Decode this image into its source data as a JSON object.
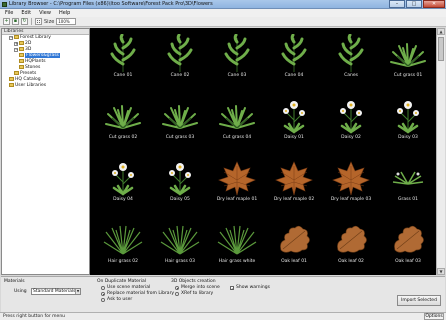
{
  "window": {
    "title": "Library Browser - C:\\Program Files (x86)\\Itoo Software\\Forest Pack Pro\\3D\\Flowers",
    "minimize": "–",
    "maximize": "□",
    "close": "✕"
  },
  "menu": [
    "File",
    "Edit",
    "View",
    "Help"
  ],
  "toolbar": {
    "view_label": "Size",
    "size_value": "100%"
  },
  "tree": {
    "header": "Libraries",
    "items": [
      {
        "label": "Forest Library",
        "indent": 1,
        "expander": "−",
        "selected": false
      },
      {
        "label": "2D",
        "indent": 2,
        "expander": "+",
        "selected": false
      },
      {
        "label": "3D",
        "indent": 2,
        "expander": "−",
        "selected": false
      },
      {
        "label": "Flowers&grass",
        "indent": 3,
        "expander": "",
        "selected": true
      },
      {
        "label": "HQPlants",
        "indent": 3,
        "expander": "",
        "selected": false
      },
      {
        "label": "Stones",
        "indent": 3,
        "expander": "",
        "selected": false
      },
      {
        "label": "Presets",
        "indent": 2,
        "expander": "",
        "selected": false
      },
      {
        "label": "HQ Catalog",
        "indent": 1,
        "expander": "",
        "selected": false
      },
      {
        "label": "User Libraries",
        "indent": 1,
        "expander": "",
        "selected": false
      }
    ]
  },
  "grid": {
    "items": [
      {
        "label": "Cane 01",
        "kind": "cane"
      },
      {
        "label": "Cane 02",
        "kind": "cane"
      },
      {
        "label": "Cane 03",
        "kind": "cane"
      },
      {
        "label": "Cane 04",
        "kind": "cane"
      },
      {
        "label": "Canes",
        "kind": "cane"
      },
      {
        "label": "Cut grass 01",
        "kind": "cutgrass"
      },
      {
        "label": "Cut grass 02",
        "kind": "cutgrass"
      },
      {
        "label": "Cut grass 03",
        "kind": "cutgrass"
      },
      {
        "label": "Cut grass 04",
        "kind": "cutgrass"
      },
      {
        "label": "Daisy 01",
        "kind": "daisy"
      },
      {
        "label": "Daisy 02",
        "kind": "daisy"
      },
      {
        "label": "Daisy 03",
        "kind": "daisy"
      },
      {
        "label": "Daisy 04",
        "kind": "daisy"
      },
      {
        "label": "Daisy 05",
        "kind": "daisy"
      },
      {
        "label": "Dry leaf maple 01",
        "kind": "maple"
      },
      {
        "label": "Dry leaf maple 02",
        "kind": "maple"
      },
      {
        "label": "Dry leaf maple 03",
        "kind": "maple"
      },
      {
        "label": "Grass 01",
        "kind": "grass"
      },
      {
        "label": "Hair grass 02",
        "kind": "hairgrass"
      },
      {
        "label": "Hair grass 03",
        "kind": "hairgrass"
      },
      {
        "label": "Hair grass white",
        "kind": "hairgrass"
      },
      {
        "label": "Oak leaf 01",
        "kind": "oak"
      },
      {
        "label": "Oak leaf 02",
        "kind": "oak"
      },
      {
        "label": "Oak leaf 03",
        "kind": "oak"
      },
      {
        "label": "",
        "kind": "lily"
      },
      {
        "label": "",
        "kind": "lily"
      },
      {
        "label": "",
        "kind": "cutgrass"
      },
      {
        "label": "",
        "kind": "flower"
      },
      {
        "label": "",
        "kind": "lily"
      },
      {
        "label": "",
        "kind": "cutgrass"
      }
    ]
  },
  "bottom": {
    "materials_label": "Materials",
    "using_label": "Using",
    "using_value": "Standard Materials",
    "duplicate_title": "On Duplicate Material",
    "duplicate_options": [
      "Use scene material",
      "Replace material from Library",
      "Ask to user"
    ],
    "objects_title": "3D Objects creation",
    "objects_options": [
      "Merge into scene",
      "XRef to library"
    ],
    "show_warnings": "Show warnings",
    "import_button": "Import Selected"
  },
  "status": {
    "message": "Press right button for menu",
    "options": "Options"
  },
  "colors": {
    "titlebar": "#a9c7ea",
    "selection": "#3178d6",
    "grid_bg": "#000000"
  }
}
